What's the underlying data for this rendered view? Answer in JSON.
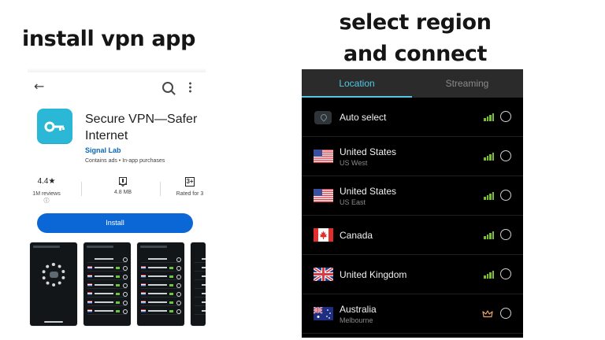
{
  "captions": {
    "install": "install vpn app",
    "connect_line1": "select region",
    "connect_line2": "and connect"
  },
  "store": {
    "toolbar": {
      "back_icon": "←",
      "search_icon": "search-icon",
      "more_icon": "more-vertical-icon"
    },
    "app": {
      "title": "Secure VPN—Safer Internet",
      "publisher": "Signal Lab",
      "meta": "Contains ads • In-app purchases",
      "icon": "key-icon",
      "icon_color": "#2bb8d6"
    },
    "stats": {
      "rating_value": "4.4★",
      "rating_label": "1M reviews ⓘ",
      "size_label": "4.8 MB",
      "age_badge": "3+",
      "age_label": "Rated for 3"
    },
    "install_label": "Install",
    "accent": "#0c67d6"
  },
  "vpn_list": {
    "tabs": [
      {
        "label": "Location"
      },
      {
        "label": "Streaming"
      }
    ],
    "locations": [
      {
        "name": "Auto select",
        "sub": "",
        "icon": "location-icon",
        "status": "signal",
        "selected": false
      },
      {
        "name": "United States",
        "sub": "US West",
        "icon": "us-flag-icon",
        "status": "signal",
        "selected": false
      },
      {
        "name": "United States",
        "sub": "US East",
        "icon": "us-flag-icon",
        "status": "signal",
        "selected": false
      },
      {
        "name": "Canada",
        "sub": "",
        "icon": "canada-flag-icon",
        "status": "signal",
        "selected": false
      },
      {
        "name": "United Kingdom",
        "sub": "",
        "icon": "uk-flag-icon",
        "status": "signal",
        "selected": false
      },
      {
        "name": "Australia",
        "sub": "Melbourne",
        "icon": "australia-flag-icon",
        "status": "premium",
        "selected": false
      }
    ],
    "accent": "#50c8e6",
    "signal_color": "#7bbd35"
  }
}
